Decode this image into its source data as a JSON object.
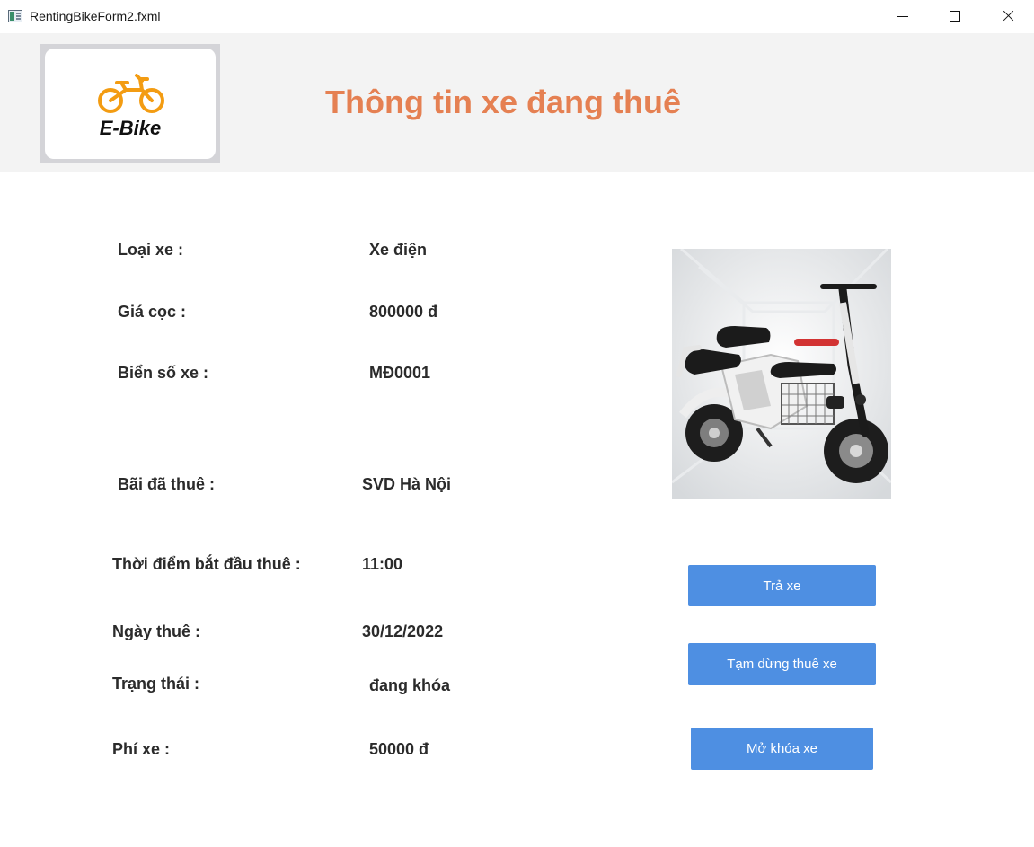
{
  "window": {
    "title": "RentingBikeForm2.fxml",
    "icon": "app-window-icon",
    "controls": [
      "minimize-icon",
      "maximize-icon",
      "close-icon"
    ]
  },
  "header": {
    "logo_text": "E-Bike",
    "logo_icon": "bicycle-icon",
    "title": "Thông tin xe đang thuê",
    "title_color": "#e58052"
  },
  "info": {
    "bike_type_label": "Loại xe :",
    "bike_type_value": "Xe điện",
    "deposit_label": "Giá cọc :",
    "deposit_value": "800000 đ",
    "plate_label": "Biển số xe :",
    "plate_value": "MĐ0001",
    "station_label": "Bãi đã thuê :",
    "station_value": "SVD Hà Nội",
    "start_time_label": "Thời điểm bắt đầu thuê :",
    "start_time_value": "11:00",
    "rent_date_label": "Ngày thuê :",
    "rent_date_value": "30/12/2022",
    "status_label": "Trạng thái :",
    "status_value": "đang khóa",
    "fee_label": "Phí xe :",
    "fee_value": "50000 đ"
  },
  "actions": {
    "return_label": "Trả xe",
    "pause_label": "Tạm dừng thuê xe",
    "unlock_label": "Mở khóa xe",
    "button_color": "#4e8fe2"
  }
}
